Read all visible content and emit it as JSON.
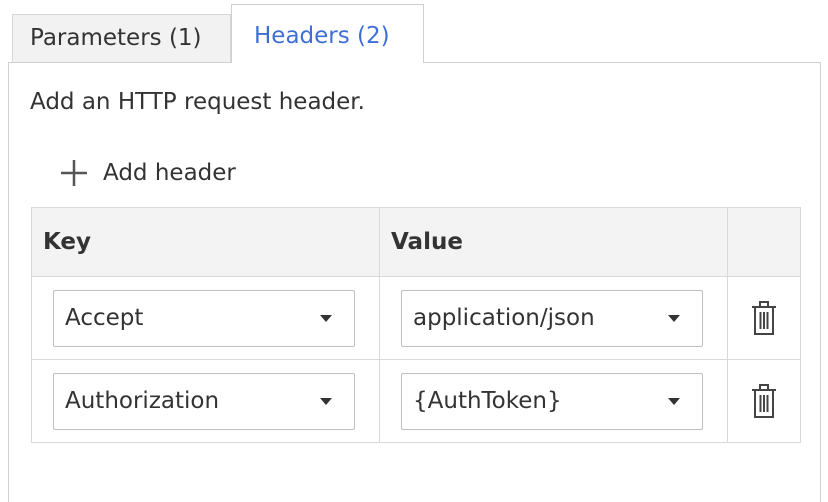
{
  "tabs": [
    {
      "label": "Parameters (1)",
      "active": false
    },
    {
      "label": "Headers (2)",
      "active": true
    }
  ],
  "panel": {
    "description": "Add an HTTP request header.",
    "add_button_label": "Add header",
    "add_icon": "plus-icon"
  },
  "table": {
    "columns": [
      "Key",
      "Value",
      ""
    ],
    "rows": [
      {
        "key": "Accept",
        "value": "application/json",
        "delete_icon": "trash-icon"
      },
      {
        "key": "Authorization",
        "value": "{AuthToken}",
        "delete_icon": "trash-icon"
      }
    ]
  },
  "colors": {
    "accent": "#3f6fd6",
    "text": "#333333",
    "border": "#d0d0d0",
    "header_bg": "#f3f3f3"
  }
}
